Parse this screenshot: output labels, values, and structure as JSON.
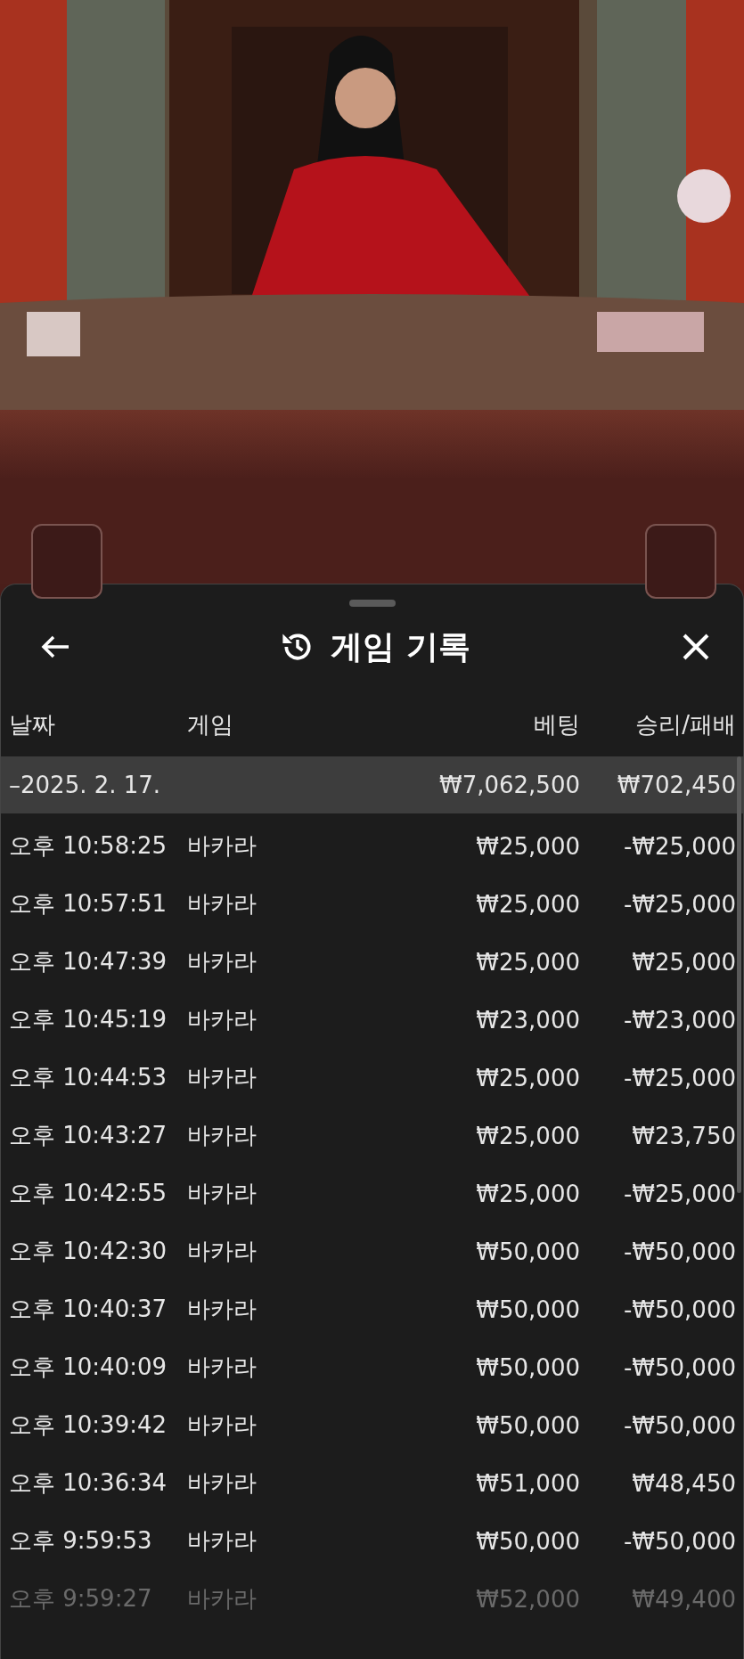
{
  "sheet": {
    "title": "게임 기록",
    "columns": [
      "날짜",
      "게임",
      "베팅",
      "승리/패배"
    ],
    "summary": {
      "date": "–2025. 2. 17.",
      "bet": "₩7,062,500",
      "result": "₩702,450"
    },
    "rows": [
      {
        "time": "오후 10:58:25",
        "game": "바카라",
        "bet": "₩25,000",
        "result": "-₩25,000",
        "faded": false
      },
      {
        "time": "오후 10:57:51",
        "game": "바카라",
        "bet": "₩25,000",
        "result": "-₩25,000",
        "faded": false
      },
      {
        "time": "오후 10:47:39",
        "game": "바카라",
        "bet": "₩25,000",
        "result": "₩25,000",
        "faded": false
      },
      {
        "time": "오후 10:45:19",
        "game": "바카라",
        "bet": "₩23,000",
        "result": "-₩23,000",
        "faded": false
      },
      {
        "time": "오후 10:44:53",
        "game": "바카라",
        "bet": "₩25,000",
        "result": "-₩25,000",
        "faded": false
      },
      {
        "time": "오후 10:43:27",
        "game": "바카라",
        "bet": "₩25,000",
        "result": "₩23,750",
        "faded": false
      },
      {
        "time": "오후 10:42:55",
        "game": "바카라",
        "bet": "₩25,000",
        "result": "-₩25,000",
        "faded": false
      },
      {
        "time": "오후 10:42:30",
        "game": "바카라",
        "bet": "₩50,000",
        "result": "-₩50,000",
        "faded": false
      },
      {
        "time": "오후 10:40:37",
        "game": "바카라",
        "bet": "₩50,000",
        "result": "-₩50,000",
        "faded": false
      },
      {
        "time": "오후 10:40:09",
        "game": "바카라",
        "bet": "₩50,000",
        "result": "-₩50,000",
        "faded": false
      },
      {
        "time": "오후 10:39:42",
        "game": "바카라",
        "bet": "₩50,000",
        "result": "-₩50,000",
        "faded": false
      },
      {
        "time": "오후 10:36:34",
        "game": "바카라",
        "bet": "₩51,000",
        "result": "₩48,450",
        "faded": false
      },
      {
        "time": "오후 9:59:53",
        "game": "바카라",
        "bet": "₩50,000",
        "result": "-₩50,000",
        "faded": false
      },
      {
        "time": "오후 9:59:27",
        "game": "바카라",
        "bet": "₩52,000",
        "result": "₩49,400",
        "faded": true
      }
    ]
  }
}
